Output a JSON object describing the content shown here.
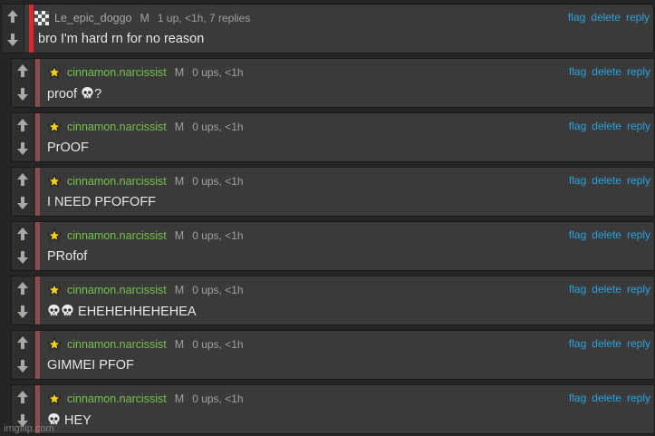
{
  "icons": {
    "upvote": "up-arrow-icon",
    "downvote": "down-arrow-icon",
    "parent_avatar": "checkered-avatar-icon",
    "reply_avatar": "star-badge-icon",
    "skull": "skull-emoji-icon"
  },
  "colors": {
    "accent_link": "#2aa3df",
    "username_green": "#78c04c",
    "parent_bar": "#e0262e",
    "reply_bar": "#8a4c4c"
  },
  "thread": {
    "parent": {
      "username": "Le_epic_doggo",
      "gender": "M",
      "stats": "1 up, <1h, 7 replies",
      "body": "bro I'm hard rn for no reason",
      "actions": {
        "flag": "flag",
        "delete": "delete",
        "reply": "reply"
      }
    },
    "replies": [
      {
        "username": "cinnamon.narcissist",
        "gender": "M",
        "stats": "0 ups, <1h",
        "pre": "proof ",
        "skulls": 1,
        "post": "?"
      },
      {
        "username": "cinnamon.narcissist",
        "gender": "M",
        "stats": "0 ups, <1h",
        "pre": "PrOOF",
        "skulls": 0,
        "post": ""
      },
      {
        "username": "cinnamon.narcissist",
        "gender": "M",
        "stats": "0 ups, <1h",
        "pre": "I NEED PFOFOFF",
        "skulls": 0,
        "post": ""
      },
      {
        "username": "cinnamon.narcissist",
        "gender": "M",
        "stats": "0 ups, <1h",
        "pre": "PRofof",
        "skulls": 0,
        "post": ""
      },
      {
        "username": "cinnamon.narcissist",
        "gender": "M",
        "stats": "0 ups, <1h",
        "pre": "",
        "skulls": 2,
        "post": " EHEHEHHEHEHEA"
      },
      {
        "username": "cinnamon.narcissist",
        "gender": "M",
        "stats": "0 ups, <1h",
        "pre": "GIMMEI PFOF",
        "skulls": 0,
        "post": ""
      },
      {
        "username": "cinnamon.narcissist",
        "gender": "M",
        "stats": "0 ups, <1h",
        "pre": "",
        "skulls": 1,
        "post": " HEY"
      }
    ],
    "reply_actions": {
      "flag": "flag",
      "delete": "delete",
      "reply": "reply"
    }
  },
  "watermark": "imgflip.com"
}
